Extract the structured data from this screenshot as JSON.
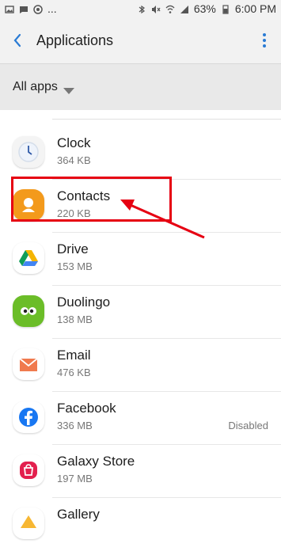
{
  "status_bar": {
    "dots": "...",
    "battery": "63%",
    "time": "6:00 PM"
  },
  "header": {
    "title": "Applications",
    "back_icon": "back-arrow-icon",
    "menu_icon": "overflow-menu-icon"
  },
  "filter": {
    "label": "All apps",
    "icon": "dropdown-caret-icon"
  },
  "apps": [
    {
      "name": "Clock",
      "size": "364 KB",
      "status": "",
      "icon": "clock-icon",
      "color": "#eef3fb"
    },
    {
      "name": "Contacts",
      "size": "220 KB",
      "status": "",
      "icon": "contacts-icon",
      "color": "#f39a1c"
    },
    {
      "name": "Drive",
      "size": "153 MB",
      "status": "",
      "icon": "drive-icon",
      "color": "#ffffff"
    },
    {
      "name": "Duolingo",
      "size": "138 MB",
      "status": "",
      "icon": "duolingo-icon",
      "color": "#6bbd28"
    },
    {
      "name": "Email",
      "size": "476 KB",
      "status": "",
      "icon": "email-icon",
      "color": "#f07a4e"
    },
    {
      "name": "Facebook",
      "size": "336 MB",
      "status": "Disabled",
      "icon": "facebook-icon",
      "color": "#1877f2"
    },
    {
      "name": "Galaxy Store",
      "size": "197 MB",
      "status": "",
      "icon": "galaxy-store-icon",
      "color": "#e3204e"
    },
    {
      "name": "Gallery",
      "size": "",
      "status": "",
      "icon": "gallery-icon",
      "color": "#f7b733"
    }
  ],
  "annotation": {
    "highlight_color": "#e60012"
  }
}
